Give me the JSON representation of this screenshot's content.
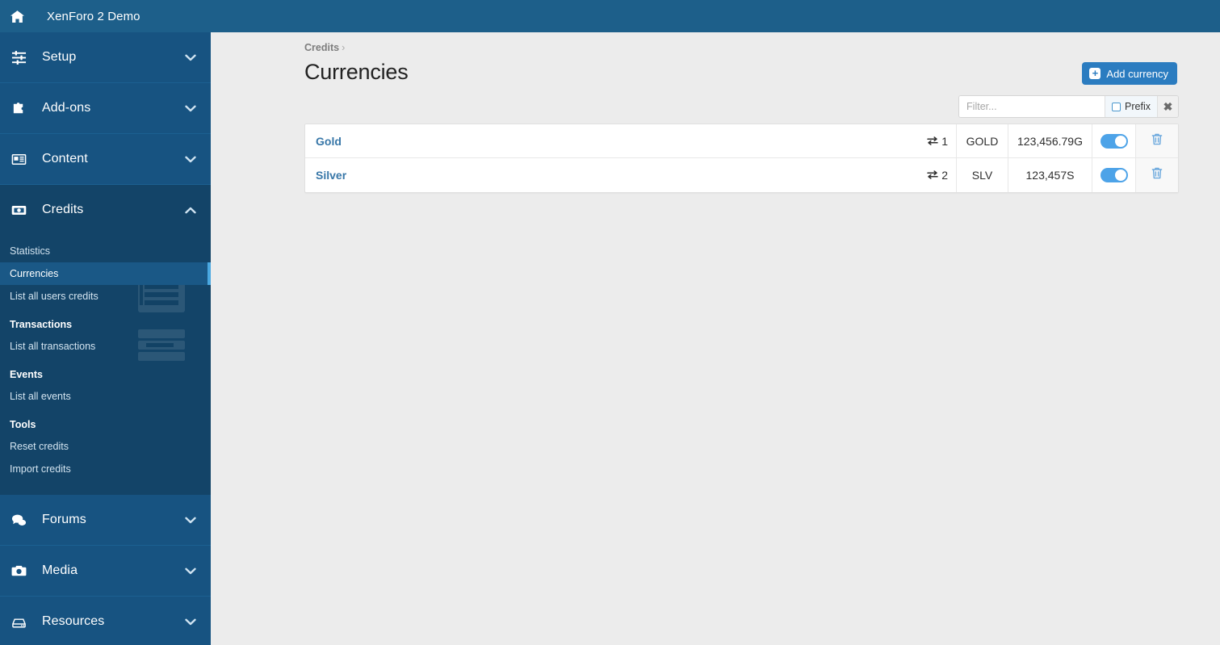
{
  "topbar": {
    "home_icon": "home-icon",
    "site_title": "XenForo 2 Demo"
  },
  "sidebar": {
    "groups": [
      {
        "label": "Setup",
        "icon": "sliders-icon",
        "chevron": "chevron-down-icon",
        "expanded": false
      },
      {
        "label": "Add-ons",
        "icon": "puzzle-icon",
        "chevron": "chevron-down-icon",
        "expanded": false
      },
      {
        "label": "Content",
        "icon": "newspaper-icon",
        "chevron": "chevron-down-icon",
        "expanded": false
      },
      {
        "label": "Credits",
        "icon": "banknote-icon",
        "chevron": "chevron-up-icon",
        "expanded": true
      },
      {
        "label": "Forums",
        "icon": "comments-icon",
        "chevron": "chevron-down-icon",
        "expanded": false
      },
      {
        "label": "Media",
        "icon": "camera-icon",
        "chevron": "chevron-down-icon",
        "expanded": false
      },
      {
        "label": "Resources",
        "icon": "drive-icon",
        "chevron": "chevron-down-icon",
        "expanded": false
      }
    ],
    "credits_submenu": {
      "links": [
        {
          "label": "Statistics",
          "selected": false
        },
        {
          "label": "Currencies",
          "selected": true
        },
        {
          "label": "List all users credits",
          "selected": false
        }
      ],
      "sections": [
        {
          "heading": "Transactions",
          "links": [
            {
              "label": "List all transactions"
            }
          ]
        },
        {
          "heading": "Events",
          "links": [
            {
              "label": "List all events"
            }
          ]
        },
        {
          "heading": "Tools",
          "links": [
            {
              "label": "Reset credits"
            },
            {
              "label": "Import credits"
            }
          ]
        }
      ]
    }
  },
  "main": {
    "breadcrumb": {
      "label": "Credits",
      "separator": "›"
    },
    "page_title": "Currencies",
    "add_button": {
      "label": "Add currency",
      "icon": "plus-icon"
    },
    "filter": {
      "placeholder": "Filter...",
      "value": "",
      "prefix_label": "Prefix",
      "prefix_checked": false,
      "clear_icon": "✖"
    },
    "table": {
      "rows": [
        {
          "title": "Gold",
          "order_icon": "exchange-icon",
          "order": "1",
          "code": "GOLD",
          "value": "123,456.79G",
          "enabled": true,
          "delete_icon": "trash-icon"
        },
        {
          "title": "Silver",
          "order_icon": "exchange-icon",
          "order": "2",
          "code": "SLV",
          "value": "123,457S",
          "enabled": true,
          "delete_icon": "trash-icon"
        }
      ]
    }
  },
  "colors": {
    "topbar": "#1d5f8a",
    "sidebar": "#175381",
    "sidebar_active": "#134468",
    "accent_bar": "#4aa8e0",
    "link": "#3877a8",
    "button": "#2b7cc0",
    "toggle_on": "#4da3e8",
    "content_bg": "#ececec"
  }
}
